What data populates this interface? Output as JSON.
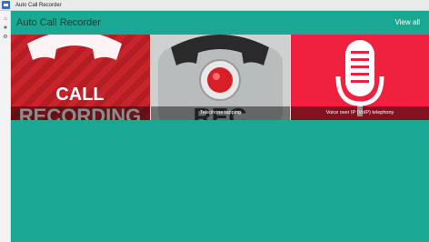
{
  "window": {
    "title": "Auto Call Recorder"
  },
  "sidebar": {
    "icons": [
      "home-icon",
      "star-icon",
      "settings-icon"
    ]
  },
  "header": {
    "title": "Auto Call Recorder",
    "view_all": "View all"
  },
  "tiles": [
    {
      "caption": "",
      "art_text": [
        "CALL",
        "RECORDING"
      ]
    },
    {
      "caption": "Telephone tapping",
      "art_text": [
        "REC"
      ]
    },
    {
      "caption": "Voice over IP (VoIP) telephony"
    }
  ],
  "colors": {
    "accent": "#1aa892",
    "tile1": "#c8242c",
    "tile3": "#f0213f"
  }
}
